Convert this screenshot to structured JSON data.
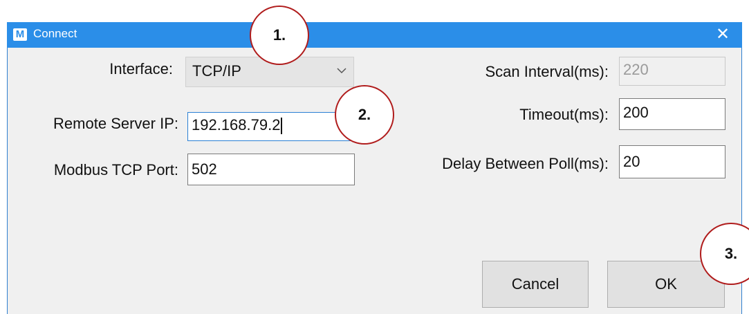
{
  "window": {
    "title": "Connect",
    "icon_letter": "M",
    "close_glyph": "✕",
    "colors": {
      "titlebar": "#2b8ee8",
      "body": "#f0f0f0",
      "callout_border": "#b01c1c"
    }
  },
  "left": {
    "interface_label": "Interface:",
    "interface_value": "TCP/IP",
    "remote_ip_label": "Remote Server IP:",
    "remote_ip_value": "192.168.79.2",
    "port_label": "Modbus TCP Port:",
    "port_value": "502"
  },
  "right": {
    "scan_label": "Scan Interval(ms):",
    "scan_value": "220",
    "timeout_label": "Timeout(ms):",
    "timeout_value": "200",
    "delay_label": "Delay Between Poll(ms):",
    "delay_value": "20"
  },
  "buttons": {
    "cancel": "Cancel",
    "ok": "OK"
  },
  "callouts": [
    "1.",
    "2.",
    "3."
  ]
}
